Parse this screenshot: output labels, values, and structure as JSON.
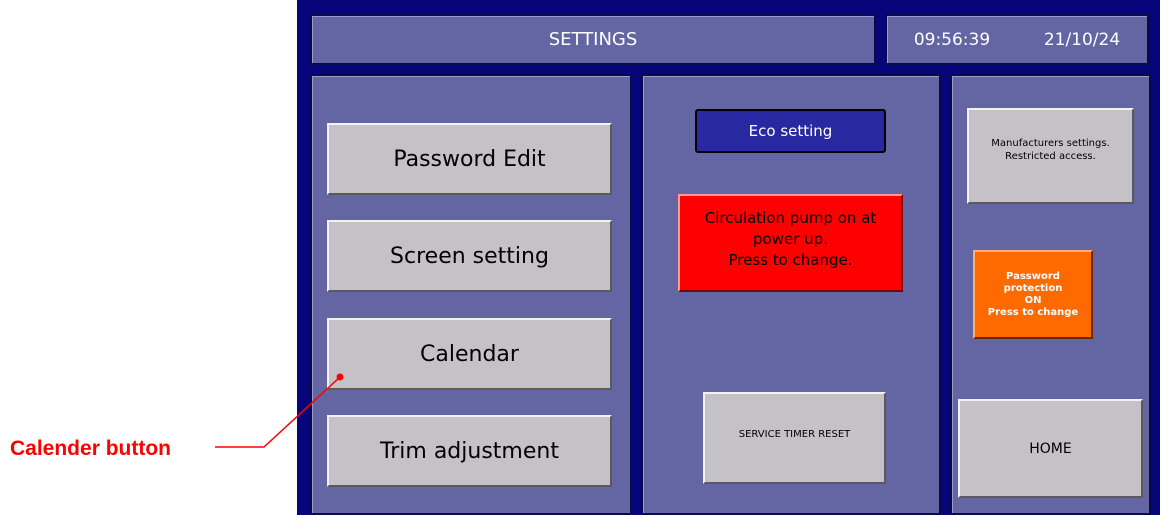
{
  "window": {
    "heading": "Settings"
  },
  "header": {
    "title": "SETTINGS",
    "time": "09:56:39",
    "date": "21/10/24"
  },
  "left_panel": {
    "buttons": [
      "Password Edit",
      "Screen setting",
      "Calendar",
      "Trim adjustment"
    ]
  },
  "middle_panel": {
    "eco_label": "Eco setting",
    "pump_button": "Circulation pump on at\npower up.\nPress to change.",
    "service_button": "SERVICE TIMER RESET"
  },
  "right_panel": {
    "manufacturer_button": "Manufacturers settings.\nRestricted access.",
    "password_protection_button": "Password protection\nON\nPress to change",
    "home_button": "HOME"
  },
  "annotation": {
    "label": "Calender button"
  },
  "colors": {
    "screen_bg": "#06067a",
    "panel_bg": "#6466a4",
    "button_bg": "#c4c2c7",
    "eco_bg": "#2828a0",
    "pump_bg": "#ff0000",
    "password_bg": "#ff6a00",
    "annotation": "#ff0000"
  }
}
